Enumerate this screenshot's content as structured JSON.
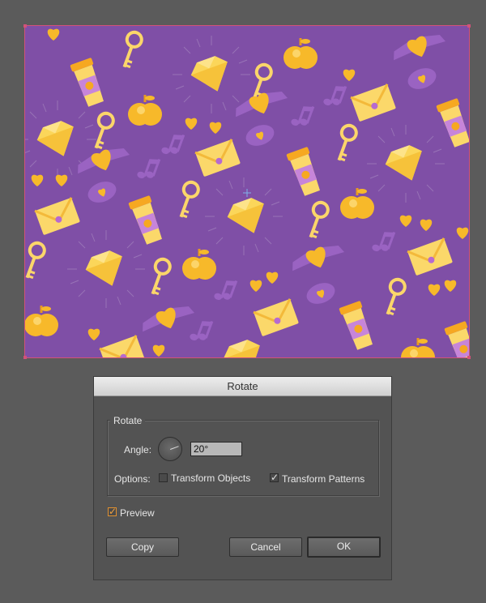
{
  "dialog": {
    "title": "Rotate",
    "group_label": "Rotate",
    "angle_label": "Angle:",
    "angle_value": "20°",
    "options_label": "Options:",
    "transform_objects": {
      "label": "Transform Objects",
      "checked": false
    },
    "transform_patterns": {
      "label": "Transform Patterns",
      "checked": true
    },
    "preview": {
      "label": "Preview",
      "checked": true
    },
    "buttons": {
      "copy": "Copy",
      "cancel": "Cancel",
      "ok": "OK"
    }
  },
  "artboard": {
    "background_color": "#7f4fa6",
    "pattern_color": "#f8c83a",
    "pattern_icons": [
      "coffee-cup-icon",
      "key-icon",
      "diamond-icon",
      "apple-icon",
      "heart-wings-icon",
      "envelope-icon",
      "music-note-icon",
      "speech-bubble-icon"
    ]
  }
}
